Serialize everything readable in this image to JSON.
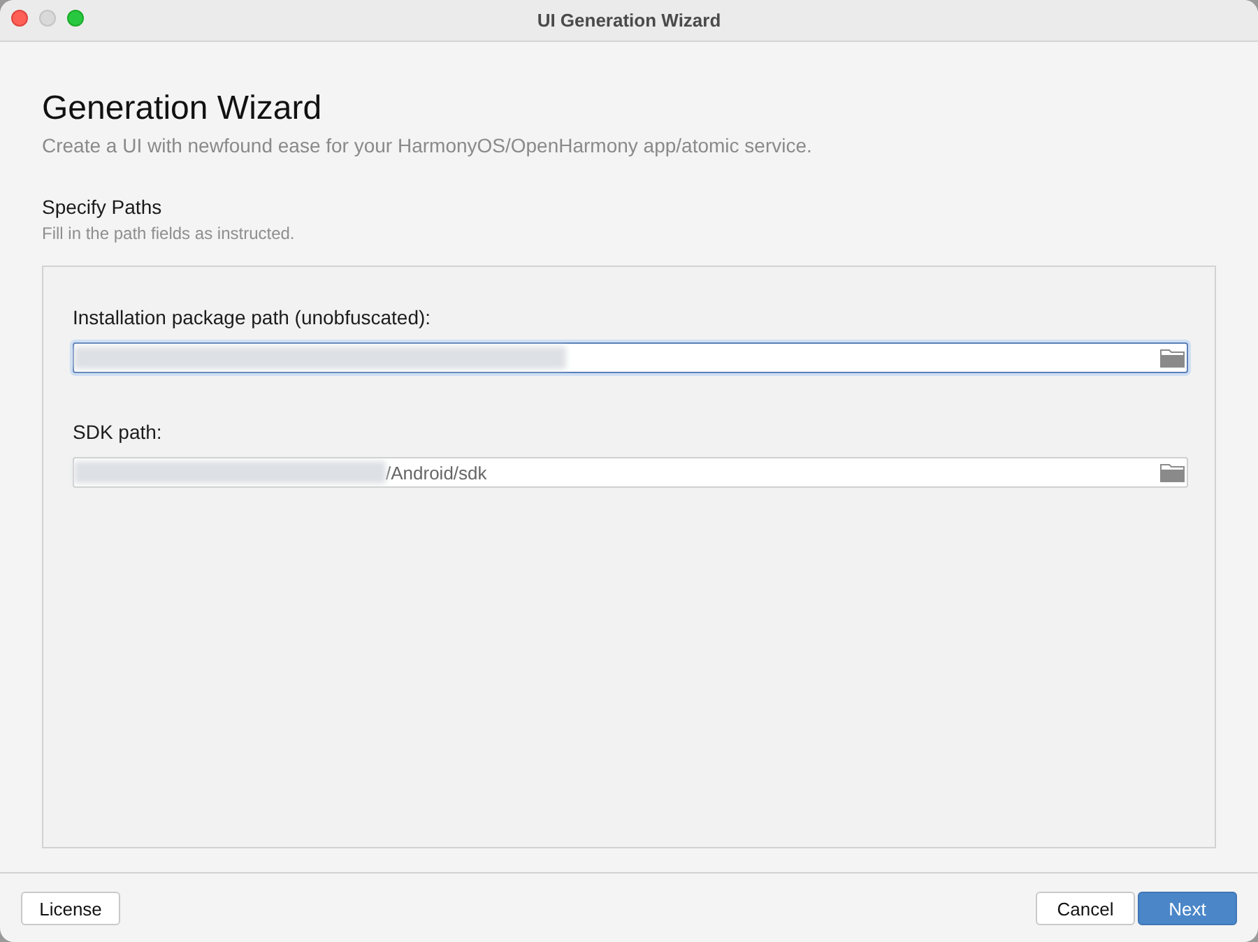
{
  "window": {
    "title": "UI Generation Wizard",
    "controls": [
      {
        "kind": "close",
        "disabled": false
      },
      {
        "kind": "minimize",
        "disabled": true
      },
      {
        "kind": "zoom",
        "disabled": false
      }
    ]
  },
  "header": {
    "title": "Generation Wizard",
    "subtitle": "Create a UI with newfound ease for your HarmonyOS/OpenHarmony app/atomic service."
  },
  "section": {
    "title": "Specify Paths",
    "hint": "Fill in the path fields as instructed.",
    "fields": [
      {
        "label": "Installation package path (unobfuscated):",
        "redacted": true,
        "focused": true
      },
      {
        "label": "SDK path:",
        "redacted": true,
        "focused": false,
        "value": "/Android/sdk"
      }
    ]
  },
  "footer": {
    "left_buttons": [
      {
        "label": "License",
        "kind": "default"
      }
    ],
    "right_buttons": [
      {
        "label": "Cancel",
        "kind": "default"
      },
      {
        "label": "Next",
        "kind": "primary"
      }
    ]
  }
}
